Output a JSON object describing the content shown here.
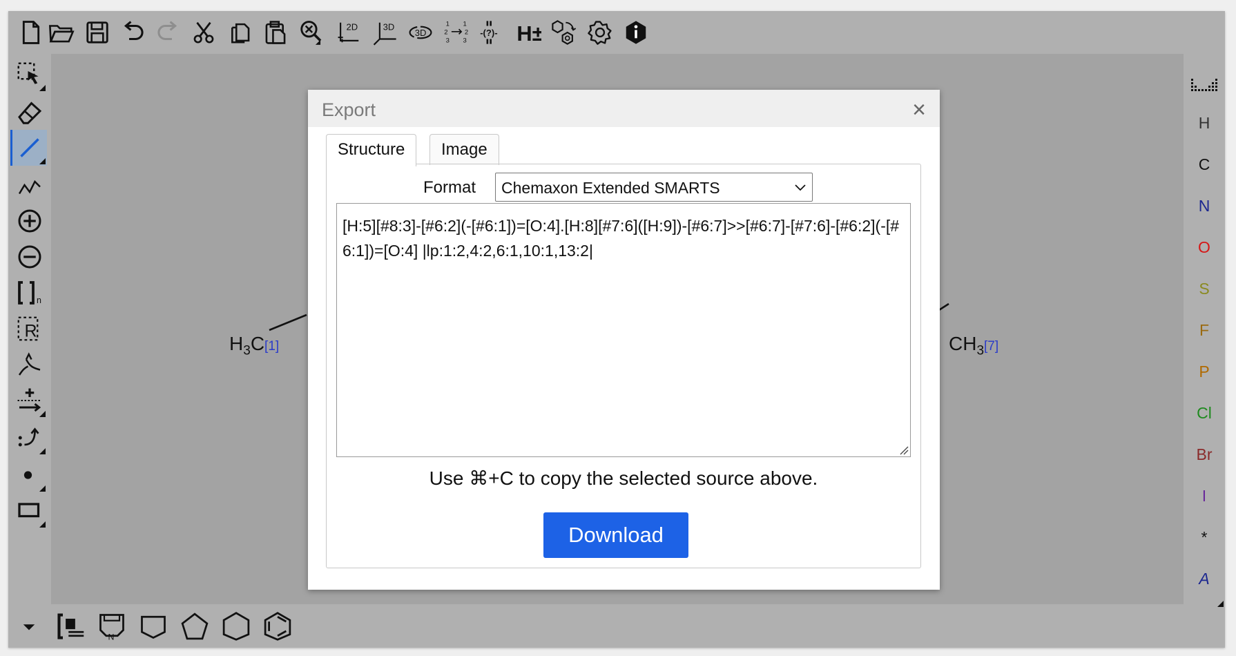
{
  "toolbar": {
    "top": [
      {
        "id": "new",
        "label": ""
      },
      {
        "id": "open",
        "label": ""
      },
      {
        "id": "save",
        "label": ""
      },
      {
        "id": "undo",
        "label": ""
      },
      {
        "id": "redo",
        "label": ""
      },
      {
        "id": "cut",
        "label": ""
      },
      {
        "id": "copy",
        "label": ""
      },
      {
        "id": "paste",
        "label": ""
      },
      {
        "id": "zoom",
        "label": ""
      },
      {
        "id": "clean2d",
        "label": "2D"
      },
      {
        "id": "clean3d",
        "label": "3D"
      },
      {
        "id": "view3d",
        "label": "3D"
      },
      {
        "id": "renumber",
        "label": ""
      },
      {
        "id": "query",
        "label": "-(?)-"
      },
      {
        "id": "hydrogens",
        "label": "H±"
      },
      {
        "id": "transform",
        "label": ""
      },
      {
        "id": "settings",
        "label": ""
      },
      {
        "id": "info",
        "label": ""
      }
    ],
    "right_elements": [
      "H",
      "C",
      "N",
      "O",
      "S",
      "F",
      "P",
      "Cl",
      "Br",
      "I",
      "*",
      "A"
    ],
    "right_colors": {
      "H": "#333333",
      "C": "#111111",
      "N": "#1c2790",
      "O": "#d61717",
      "S": "#8a8a20",
      "F": "#9a6a10",
      "P": "#b06a00",
      "Cl": "#1f8a1f",
      "Br": "#8a2a2a",
      "I": "#6a2a9a",
      "*": "#111111",
      "A": "#1c2790"
    },
    "left_tools": [
      "select",
      "eraser",
      "single-bond",
      "chain",
      "charge-plus",
      "charge-minus",
      "sgroup",
      "rgroup",
      "reaction-arrow",
      "plus-arrow",
      "mapping",
      "radical",
      "shape"
    ],
    "left_sgroup_sub": "n",
    "left_rgroup_label": "R",
    "bottom_templates": [
      "template-library",
      "ring-n",
      "cyclobutane",
      "cyclopentane",
      "cyclohexane",
      "benzene"
    ],
    "bottom_ring_n_label": "N"
  },
  "canvas": {
    "left_label": {
      "main": "H",
      "sub": "3",
      "tail": "C",
      "index": "[1]"
    },
    "right_label": {
      "main": "CH",
      "sub": "3",
      "index": "[7]"
    }
  },
  "dialog": {
    "title": "Export",
    "close": "×",
    "tabs": [
      "Structure",
      "Image"
    ],
    "active_tab": "Structure",
    "format_label": "Format",
    "format_value": "Chemaxon Extended SMARTS",
    "source": "[H:5][#8:3]-[#6:2](-[#6:1])=[O:4].[H:8][#7:6]([H:9])-[#6:7]>>[#6:7]-[#7:6]-[#6:2](-[#6:1])=[O:4] |lp:1:2,4:2,6:1,10:1,13:2|",
    "copy_hint": "Use ⌘+C to copy the selected source above.",
    "download_label": "Download"
  }
}
